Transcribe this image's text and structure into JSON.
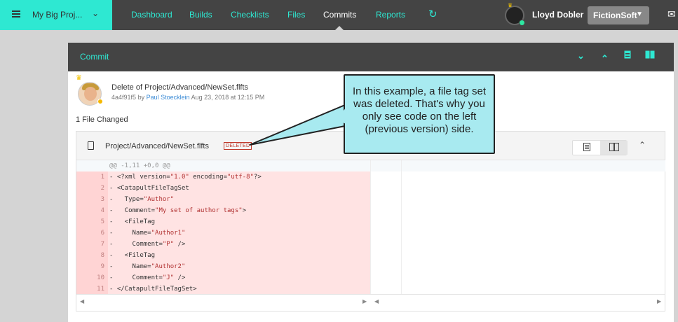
{
  "topbar": {
    "project_name": "My Big Proj...",
    "nav": [
      "Dashboard",
      "Builds",
      "Checklists",
      "Files",
      "Commits",
      "Reports"
    ],
    "active_nav": "Commits",
    "user_name": "Lloyd Dobler",
    "org_name": "FictionSoft",
    "icons": [
      "menu-icon",
      "chevron-down-icon",
      "refresh-icon",
      "mail-icon"
    ]
  },
  "card": {
    "title": "Commit",
    "header_icons": [
      "expand-all-icon",
      "collapse-all-icon",
      "unified-view-icon",
      "split-view-icon"
    ]
  },
  "commit": {
    "message": "Delete of Project/Advanced/NewSet.flfts",
    "hash": "4a4f91f5",
    "by": "by",
    "author": "Paul Stoecklein",
    "date": "Aug 23, 2018 at 12:15 PM",
    "files_changed": "1 File Changed"
  },
  "diff": {
    "file_path": "Project/Advanced/NewSet.flfts",
    "status_badge": "DELETED",
    "hunk": "@@ -1,11 +0,0 @@",
    "lines": [
      {
        "n": "1",
        "text": "- <?xml version=\"1.0\" encoding=\"utf-8\"?>"
      },
      {
        "n": "2",
        "text": "- <CatapultFileTagSet"
      },
      {
        "n": "3",
        "text": "-   Type=\"Author\""
      },
      {
        "n": "4",
        "text": "-   Comment=\"My set of author tags\">"
      },
      {
        "n": "5",
        "text": "-   <FileTag"
      },
      {
        "n": "6",
        "text": "-     Name=\"Author1\""
      },
      {
        "n": "7",
        "text": "-     Comment=\"P\" />"
      },
      {
        "n": "8",
        "text": "-   <FileTag"
      },
      {
        "n": "9",
        "text": "-     Name=\"Author2\""
      },
      {
        "n": "10",
        "text": "-     Comment=\"J\" />"
      },
      {
        "n": "11",
        "text": "- </CatapultFileTagSet>"
      }
    ]
  },
  "callout": {
    "text": "In this example, a file tag set was deleted. That's why you only see code on the left (previous version) side."
  },
  "colors": {
    "accent": "#2ee8d2",
    "topbar": "#444444",
    "deleted_bg": "#ffe3e3",
    "callout_bg": "#a8eaf0"
  }
}
